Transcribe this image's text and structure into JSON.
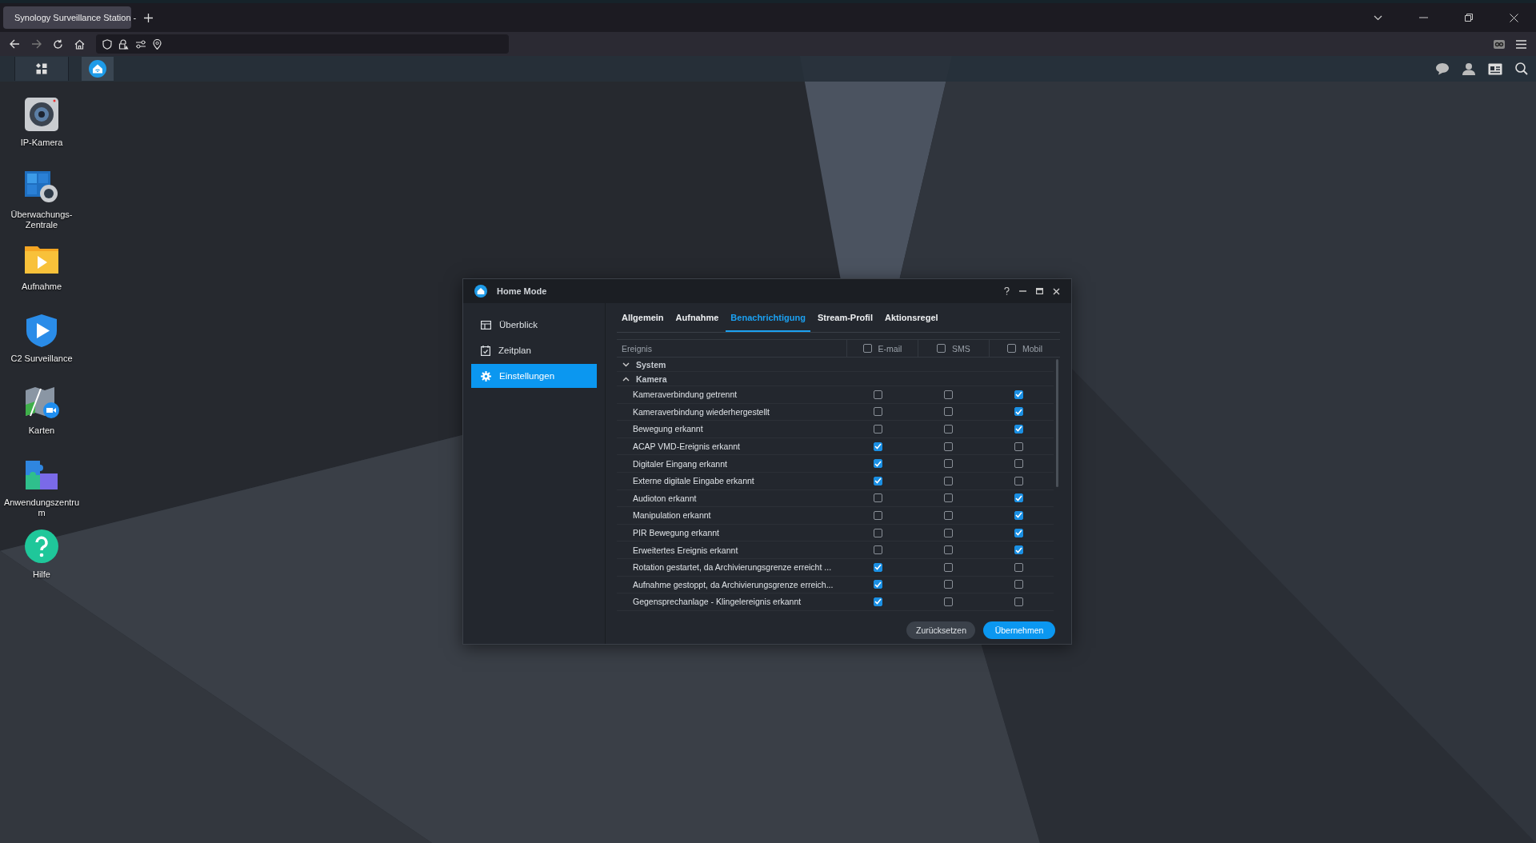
{
  "browser": {
    "tab": {
      "title": "Synology Surveillance Station -",
      "selected": true
    }
  },
  "taskbar": {
    "buttons": [
      {
        "selected": false
      },
      {
        "selected": true
      }
    ]
  },
  "desktop": {
    "icons": [
      {
        "label": "IP-Kamera"
      },
      {
        "label": "Überwachungs-Zentrale"
      },
      {
        "label": "Aufnahme"
      },
      {
        "label": "C2 Surveillance"
      },
      {
        "label": "Karten"
      },
      {
        "label": "Anwendungszentrum"
      },
      {
        "label": "Hilfe"
      }
    ]
  },
  "dialog": {
    "title": "Home Mode",
    "sidebar": {
      "items": [
        {
          "label": "Überblick",
          "selected": false
        },
        {
          "label": "Zeitplan",
          "selected": false
        },
        {
          "label": "Einstellungen",
          "selected": true
        }
      ]
    },
    "tabs": [
      {
        "label": "Allgemein",
        "selected": false
      },
      {
        "label": "Aufnahme",
        "selected": false
      },
      {
        "label": "Benachrichtigung",
        "selected": true
      },
      {
        "label": "Stream-Profil",
        "selected": false
      },
      {
        "label": "Aktionsregel",
        "selected": false
      }
    ],
    "table": {
      "event_column": "Ereignis",
      "channels": [
        {
          "label": "E-mail",
          "checked": false
        },
        {
          "label": "SMS",
          "checked": false
        },
        {
          "label": "Mobil",
          "checked": false
        }
      ],
      "groups": [
        {
          "label": "System",
          "expanded": false
        },
        {
          "label": "Kamera",
          "expanded": true,
          "rows": [
            {
              "label": "Kameraverbindung getrennt",
              "checks": [
                false,
                false,
                true
              ]
            },
            {
              "label": "Kameraverbindung wiederhergestellt",
              "checks": [
                false,
                false,
                true
              ]
            },
            {
              "label": "Bewegung erkannt",
              "checks": [
                false,
                false,
                true
              ]
            },
            {
              "label": "ACAP VMD-Ereignis erkannt",
              "checks": [
                true,
                false,
                false
              ]
            },
            {
              "label": "Digitaler Eingang erkannt",
              "checks": [
                true,
                false,
                false
              ]
            },
            {
              "label": "Externe digitale Eingabe erkannt",
              "checks": [
                true,
                false,
                false
              ]
            },
            {
              "label": "Audioton erkannt",
              "checks": [
                false,
                false,
                true
              ]
            },
            {
              "label": "Manipulation erkannt",
              "checks": [
                false,
                false,
                true
              ]
            },
            {
              "label": "PIR Bewegung erkannt",
              "checks": [
                false,
                false,
                true
              ]
            },
            {
              "label": "Erweitertes Ereignis erkannt",
              "checks": [
                false,
                false,
                true
              ]
            },
            {
              "label": "Rotation gestartet, da Archivierungsgrenze erreicht ...",
              "checks": [
                true,
                false,
                false
              ]
            },
            {
              "label": "Aufnahme gestoppt, da Archivierungsgrenze erreich...",
              "checks": [
                true,
                false,
                false
              ]
            },
            {
              "label": "Gegensprechanlage - Klingelereignis erkannt",
              "checks": [
                true,
                false,
                false
              ]
            }
          ]
        }
      ]
    },
    "buttons": [
      {
        "label": "Zurücksetzen",
        "kind": "secondary"
      },
      {
        "label": "Übernehmen",
        "kind": "primary"
      }
    ]
  }
}
